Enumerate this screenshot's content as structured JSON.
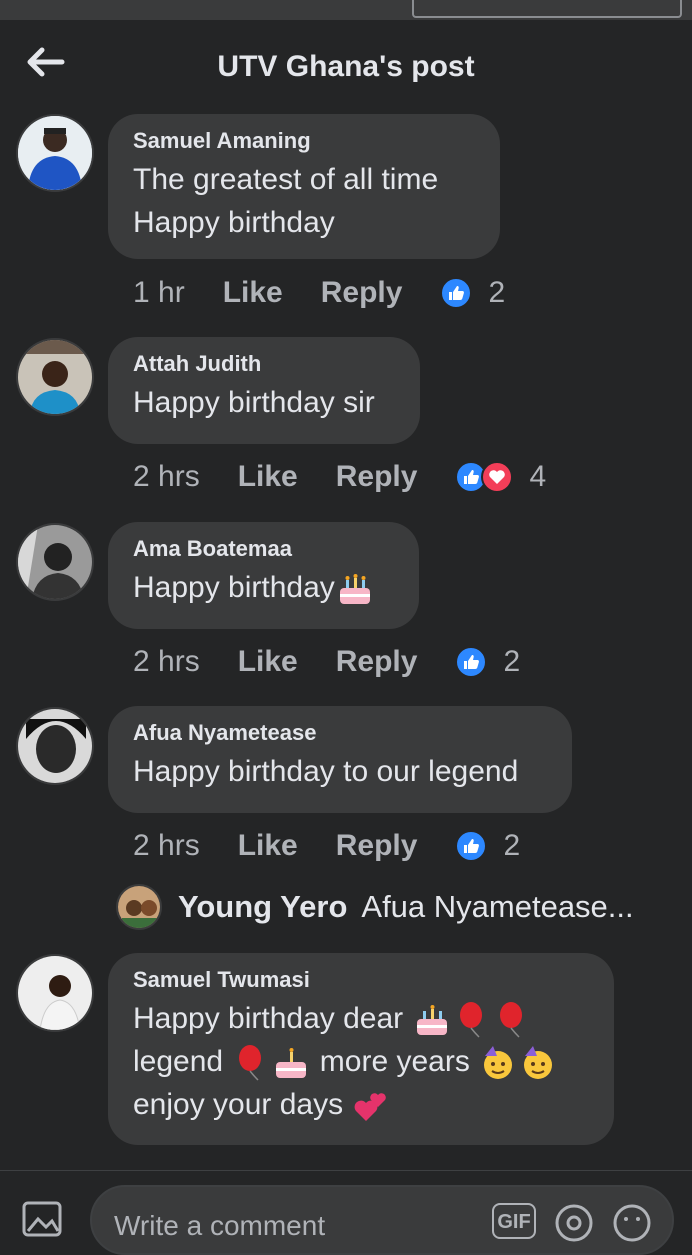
{
  "header": {
    "title": "UTV Ghana's post"
  },
  "comments": [
    {
      "author": "Samuel Amaning",
      "lines": [
        "The greatest of all time",
        "Happy birthday"
      ],
      "time": "1 hr",
      "like_label": "Like",
      "reply_label": "Reply",
      "reaction_count": "2"
    },
    {
      "author": "Attah Judith",
      "lines": [
        "Happy birthday sir"
      ],
      "time": "2 hrs",
      "like_label": "Like",
      "reply_label": "Reply",
      "reaction_count": "4"
    },
    {
      "author": "Ama Boatemaa",
      "lines": [
        "Happy birthday"
      ],
      "time": "2 hrs",
      "like_label": "Like",
      "reply_label": "Reply",
      "reaction_count": "2"
    },
    {
      "author": "Afua Nyametease",
      "lines": [
        "Happy birthday to our legend"
      ],
      "time": "2 hrs",
      "like_label": "Like",
      "reply_label": "Reply",
      "reaction_count": "2"
    },
    {
      "author": "Samuel Twumasi",
      "lines": [
        "Happy birthday dear",
        "legend",
        "more years",
        "enjoy your days"
      ]
    }
  ],
  "reply_preview": {
    "author": "Young Yero",
    "text": "Afua Nyametease..."
  },
  "composer": {
    "placeholder": "Write a comment",
    "gif_label": "GIF"
  },
  "colors": {
    "background": "#242526",
    "bubble": "#3a3b3c",
    "like_blue": "#2d88ff",
    "heart_red": "#f33e58"
  }
}
